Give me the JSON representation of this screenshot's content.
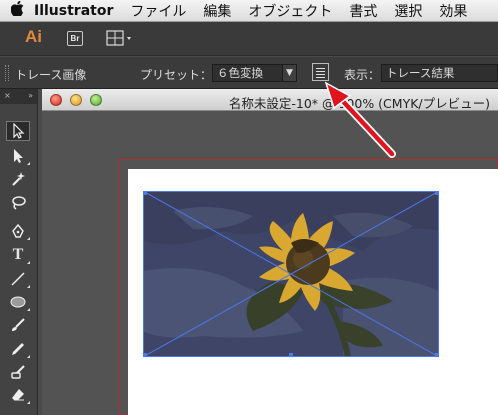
{
  "menubar": {
    "apple": "",
    "app_name": "Illustrator",
    "items": [
      "ファイル",
      "編集",
      "オブジェクト",
      "書式",
      "選択",
      "効果"
    ]
  },
  "appbar": {
    "logo": "Ai",
    "bridge_label": "Br"
  },
  "control_bar": {
    "title": "トレース画像",
    "preset_label": "プリセット：",
    "preset_value": "６色変換",
    "view_label": "表示：",
    "view_value": "トレース結果"
  },
  "document": {
    "title": "名称未設定-10* @ 100% (CMYK/プレビュー)"
  },
  "toolbar": {
    "collapse_glyph": "×",
    "expand_glyph": "»"
  },
  "colors": {
    "accent_red": "#e0141e",
    "selection_blue": "#4a78e8",
    "artboard_border": "#b03030",
    "logo_orange": "#e0883c"
  }
}
